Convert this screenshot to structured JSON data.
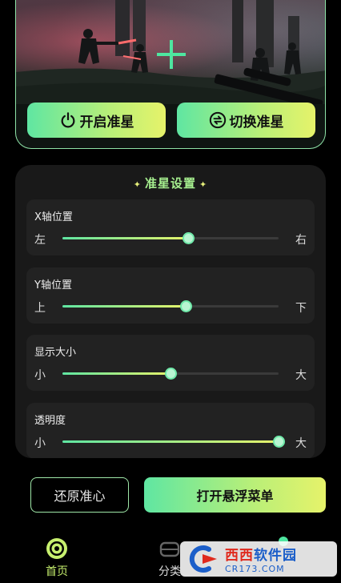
{
  "hero": {
    "scene_image": "battlefield-soldiers-artwork",
    "crosshair_icon": "crosshair-plus-icon",
    "crosshair_color": "#4EE6A0",
    "buttons": [
      {
        "label": "开启准星",
        "icon": "power-icon"
      },
      {
        "label": "切换准星",
        "icon": "switch-cycle-icon"
      }
    ]
  },
  "settings": {
    "title": "准星设置",
    "sliders": [
      {
        "label": "X轴位置",
        "min_label": "左",
        "max_label": "右",
        "value": 0.58
      },
      {
        "label": "Y轴位置",
        "min_label": "上",
        "max_label": "下",
        "value": 0.57
      },
      {
        "label": "显示大小",
        "min_label": "小",
        "max_label": "大",
        "value": 0.5
      },
      {
        "label": "透明度",
        "min_label": "小",
        "max_label": "大",
        "value": 1.0
      }
    ]
  },
  "actions": {
    "reset_label": "还原准心",
    "float_menu_label": "打开悬浮菜单"
  },
  "tabbar": {
    "items": [
      {
        "label": "首页",
        "icon": "target-icon",
        "active": true
      },
      {
        "label": "分类",
        "icon": "category-icon",
        "active": false
      }
    ]
  },
  "watermark": {
    "name_part1": "西西",
    "name_part2": "软件园",
    "url": "CR173.COM"
  },
  "colors": {
    "accent_green": "#5FE6A2",
    "accent_yellow": "#E6F36A",
    "panel_bg": "#191919",
    "card_bg": "#222222"
  }
}
